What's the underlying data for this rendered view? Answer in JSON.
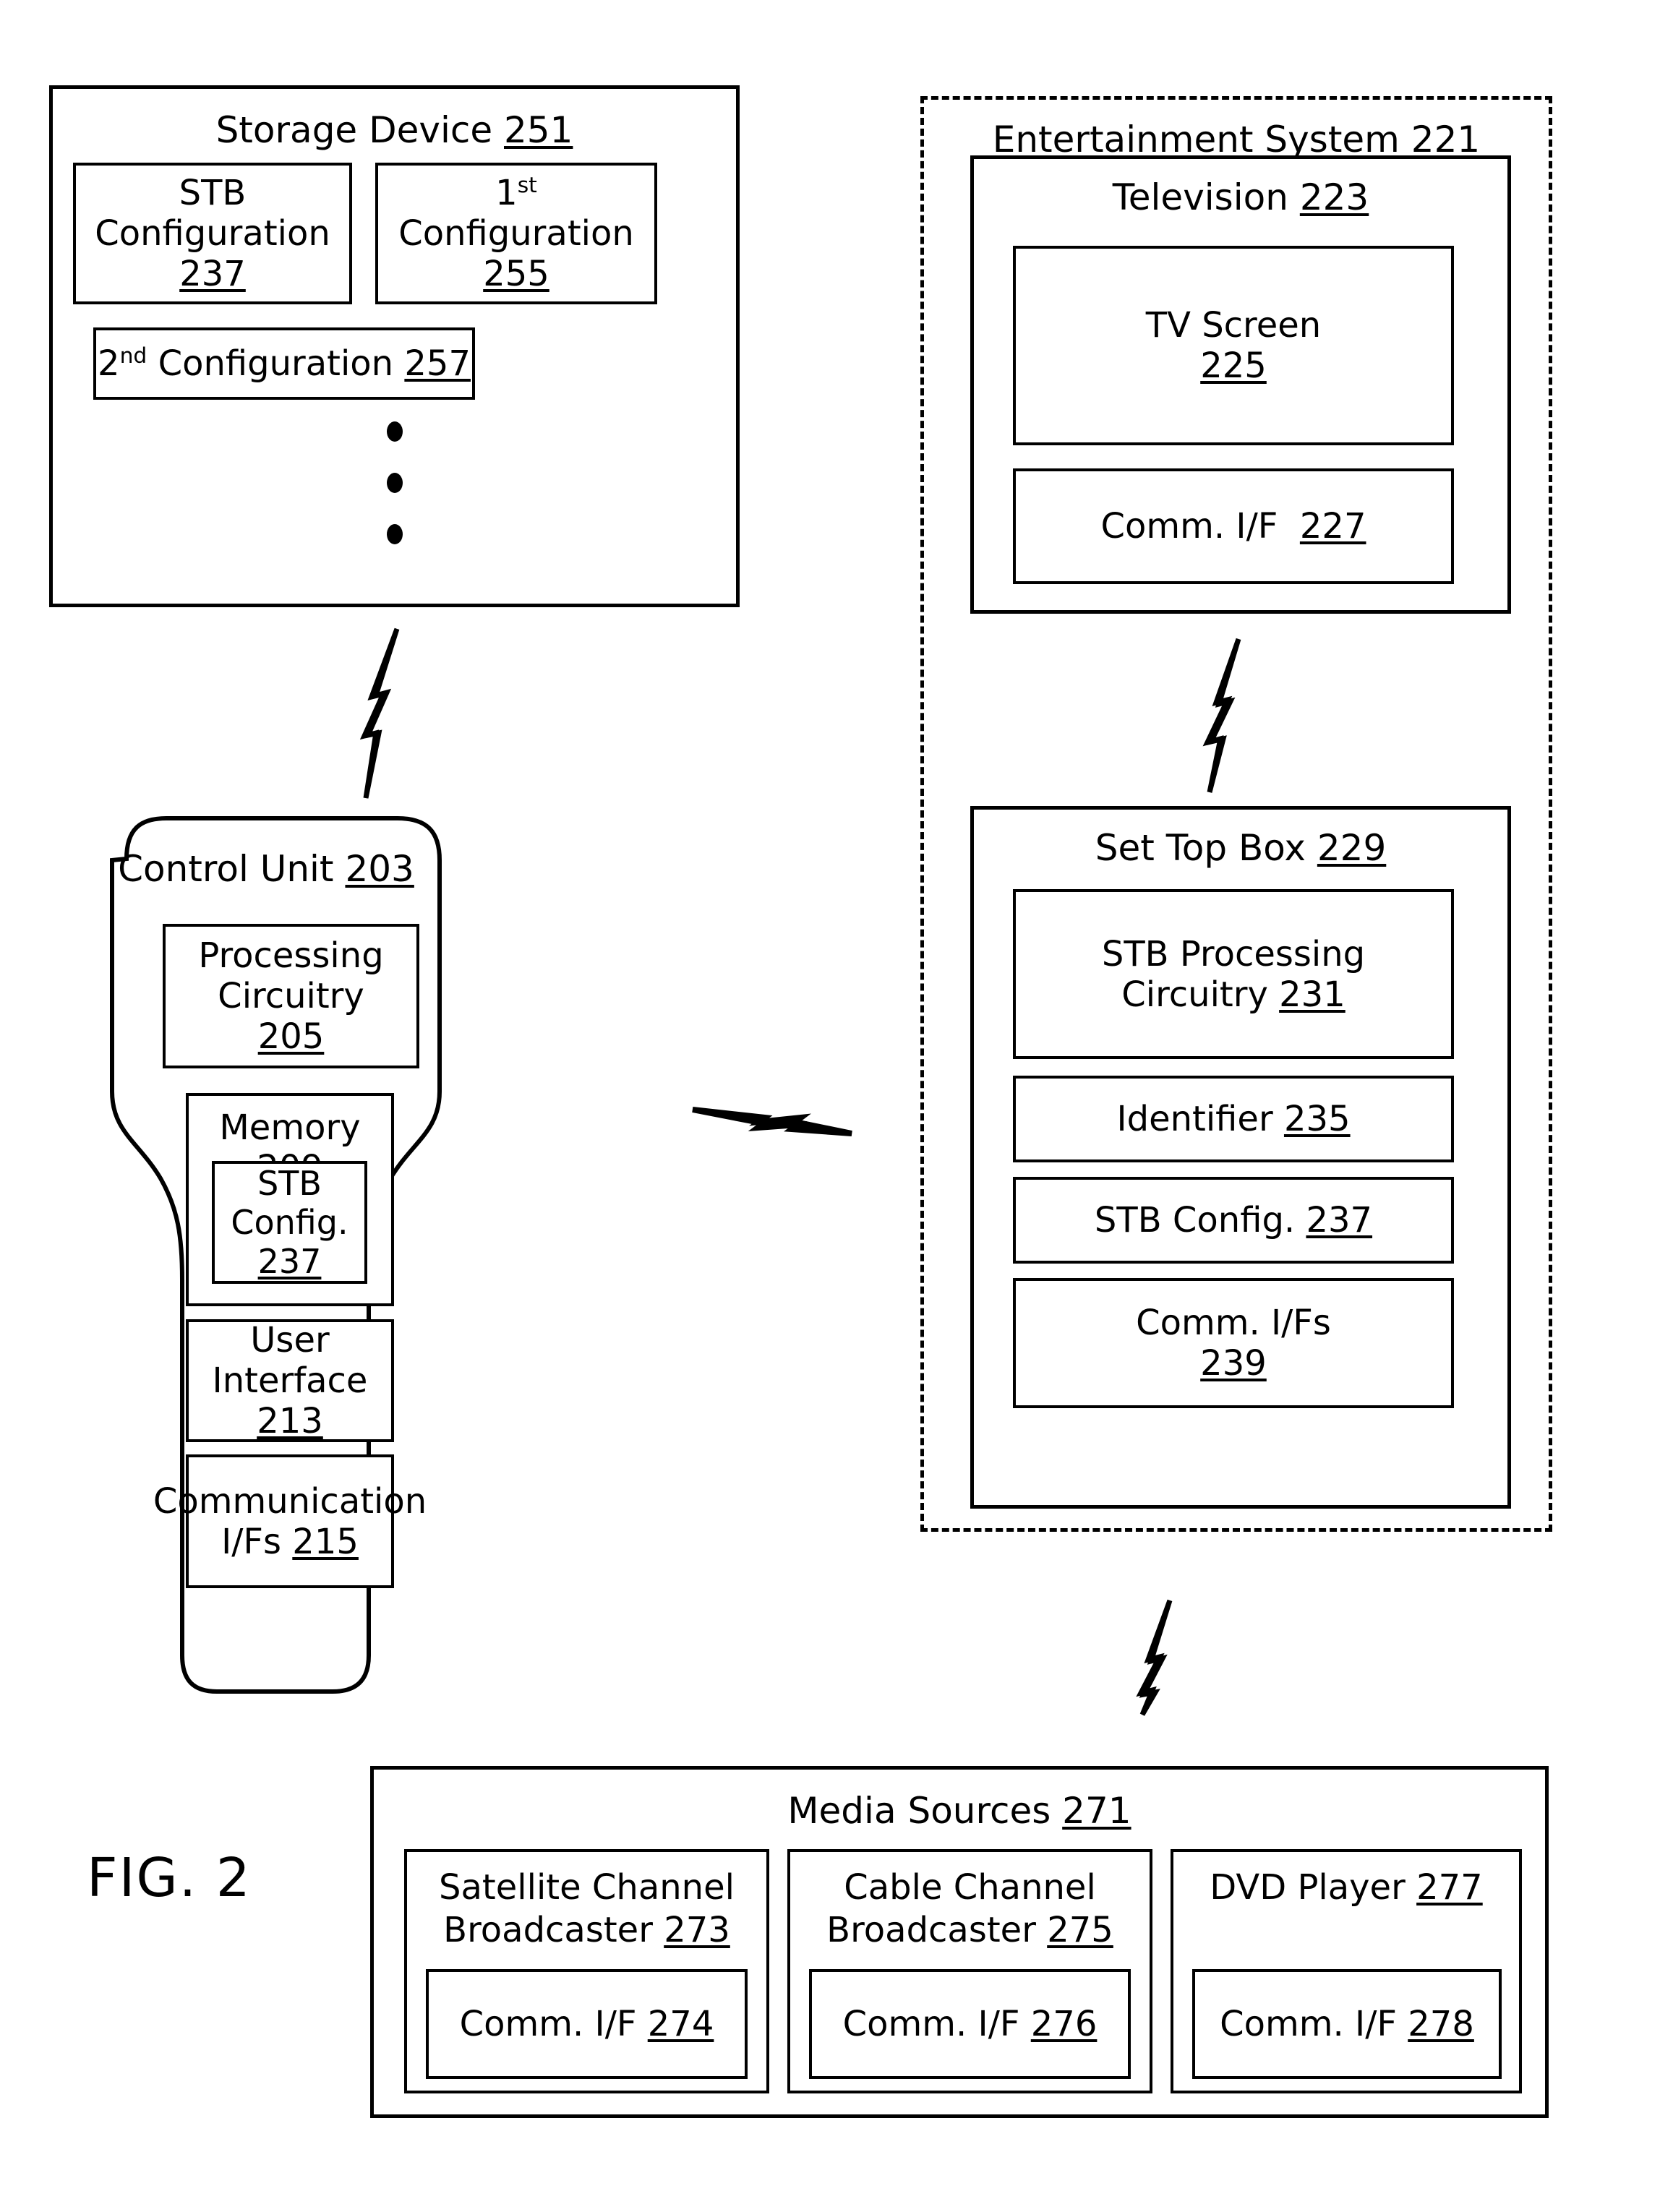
{
  "figure": {
    "caption": "FIG. 2"
  },
  "storage_device": {
    "title": "Storage Device",
    "ref": "251",
    "items": [
      {
        "label": "STB\nConfiguration",
        "ref": "237"
      },
      {
        "label": "1st\nConfiguration",
        "ref": "255"
      },
      {
        "label": "2nd Configuration",
        "ref": "257"
      }
    ],
    "ellipsis": "vertical-three-dots"
  },
  "control_unit": {
    "title": "Control Unit",
    "ref": "203",
    "processing_circuitry": {
      "label": "Processing\nCircuitry",
      "ref": "205"
    },
    "memory": {
      "label": "Memory",
      "ref": "209",
      "stb_config": {
        "label": "STB\nConfig.",
        "ref": "237"
      }
    },
    "user_interface": {
      "label": "User\nInterface",
      "ref": "213"
    },
    "communication_ifs": {
      "label": "Communication\nI/Fs",
      "ref": "215"
    }
  },
  "entertainment_system": {
    "title": "Entertainment System",
    "ref": "221",
    "television": {
      "title": "Television",
      "ref": "223",
      "tv_screen": {
        "label": "TV Screen",
        "ref": "225"
      },
      "comm_if": {
        "label": "Comm. I/F",
        "ref": "227"
      }
    },
    "set_top_box": {
      "title": "Set Top Box",
      "ref": "229",
      "items": [
        {
          "label": "STB Processing\nCircuitry",
          "ref": "231"
        },
        {
          "label": "Identifier",
          "ref": "235"
        },
        {
          "label": "STB Config.",
          "ref": "237"
        },
        {
          "label": "Comm. I/Fs",
          "ref": "239"
        }
      ]
    }
  },
  "media_sources": {
    "title": "Media Sources",
    "ref": "271",
    "sources": [
      {
        "label": "Satellite Channel\nBroadcaster",
        "ref": "273",
        "comm_if": {
          "label": "Comm. I/F",
          "ref": "274"
        }
      },
      {
        "label": "Cable Channel\nBroadcaster",
        "ref": "275",
        "comm_if": {
          "label": "Comm. I/F",
          "ref": "276"
        }
      },
      {
        "label": "DVD Player",
        "ref": "277",
        "comm_if": {
          "label": "Comm. I/F",
          "ref": "278"
        }
      }
    ]
  },
  "connectors": [
    {
      "name": "storage-to-control-unit",
      "style": "lightning-bolt",
      "orientation": "vertical"
    },
    {
      "name": "control-unit-to-entertainment-system",
      "style": "lightning-bolt",
      "orientation": "horizontal"
    },
    {
      "name": "television-to-set-top-box",
      "style": "lightning-bolt",
      "orientation": "vertical"
    },
    {
      "name": "media-sources-to-set-top-box",
      "style": "lightning-bolt",
      "orientation": "vertical"
    }
  ],
  "colors": {
    "ink": "#000000",
    "paper": "#ffffff"
  }
}
